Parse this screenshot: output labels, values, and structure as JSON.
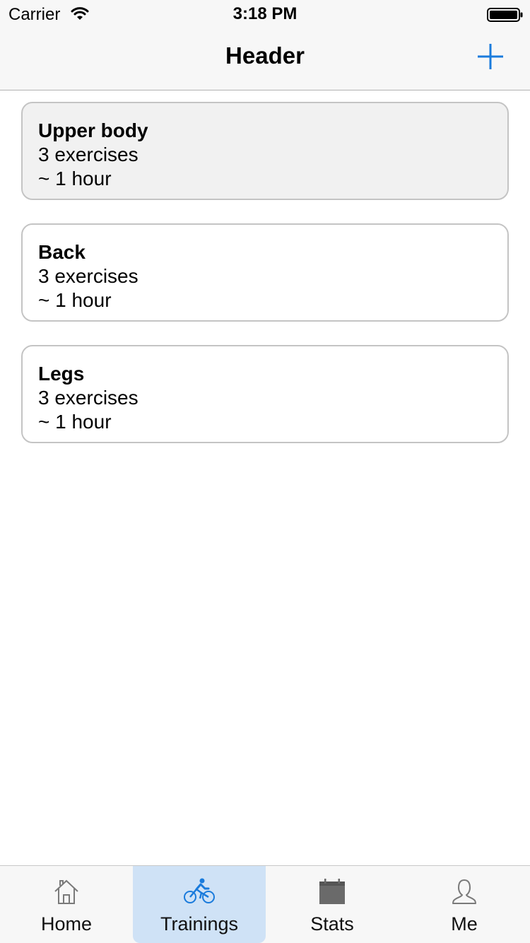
{
  "status_bar": {
    "carrier": "Carrier",
    "time": "3:18 PM"
  },
  "nav": {
    "title": "Header",
    "add_icon": "plus-icon",
    "accent_color": "#1a7bdc"
  },
  "trainings": [
    {
      "title": "Upper body",
      "exercises": "3 exercises",
      "duration": "~ 1 hour",
      "selected": true
    },
    {
      "title": "Back",
      "exercises": "3 exercises",
      "duration": "~ 1 hour",
      "selected": false
    },
    {
      "title": "Legs",
      "exercises": "3 exercises",
      "duration": "~ 1 hour",
      "selected": false
    }
  ],
  "tabs": [
    {
      "label": "Home",
      "icon": "home-icon",
      "active": false
    },
    {
      "label": "Trainings",
      "icon": "bicycle-icon",
      "active": true
    },
    {
      "label": "Stats",
      "icon": "calendar-icon",
      "active": false
    },
    {
      "label": "Me",
      "icon": "user-icon",
      "active": false
    }
  ]
}
